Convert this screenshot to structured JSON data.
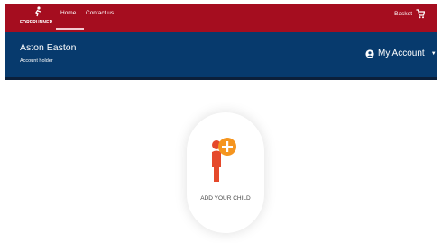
{
  "header": {
    "logo_text": "FORERUNNER",
    "nav": [
      {
        "label": "Home",
        "active": true
      },
      {
        "label": "Contact us",
        "active": false
      }
    ],
    "basket_label": "Basket",
    "basket_icon": "cart-icon"
  },
  "account_bar": {
    "user_name": "Aston Easton",
    "user_role": "Account holder",
    "account_label": "My Account",
    "account_icon": "user-circle-icon",
    "caret_icon": "caret-down-icon"
  },
  "main": {
    "add_child_label": "ADD YOUR CHILD",
    "add_child_icon": "add-child-icon"
  },
  "colors": {
    "brand_red": "#a50d1f",
    "account_blue": "#073a6d",
    "accent_orange": "#f5951f",
    "child_red": "#e5492b"
  }
}
